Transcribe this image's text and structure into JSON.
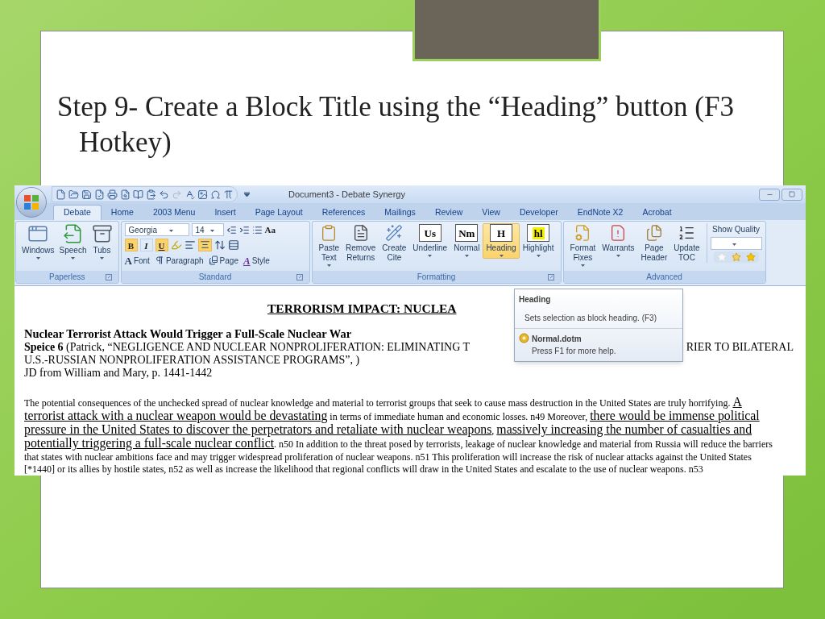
{
  "slide": {
    "title": "Step 9- Create a Block Title using the “Heading” button (F3 Hotkey)"
  },
  "window": {
    "title": "Document3 - Debate Synergy"
  },
  "tabs": [
    {
      "label": "Debate",
      "selected": true
    },
    {
      "label": "Home",
      "selected": false
    },
    {
      "label": "2003 Menu",
      "selected": false
    },
    {
      "label": "Insert",
      "selected": false
    },
    {
      "label": "Page Layout",
      "selected": false
    },
    {
      "label": "References",
      "selected": false
    },
    {
      "label": "Mailings",
      "selected": false
    },
    {
      "label": "Review",
      "selected": false
    },
    {
      "label": "View",
      "selected": false
    },
    {
      "label": "Developer",
      "selected": false
    },
    {
      "label": "EndNote X2",
      "selected": false
    },
    {
      "label": "Acrobat",
      "selected": false
    }
  ],
  "paperless": {
    "name": "Paperless",
    "buttons": [
      {
        "lines": [
          "Windows"
        ],
        "dropdown": true
      },
      {
        "lines": [
          "Speech"
        ],
        "dropdown": true
      },
      {
        "lines": [
          "Tubs"
        ],
        "dropdown": true
      }
    ]
  },
  "standard": {
    "name": "Standard",
    "font": "Georgia",
    "size": "14",
    "grow": "Aa",
    "toggles": [
      {
        "label": "B",
        "on": true
      },
      {
        "label": "I",
        "on": false
      },
      {
        "label": "U",
        "on": true
      }
    ],
    "align_center": true,
    "commands": [
      {
        "glyph": "A",
        "label": "Font"
      },
      {
        "label": "Paragraph"
      },
      {
        "label": "Page"
      },
      {
        "glyph": "A",
        "label": "Style"
      }
    ]
  },
  "formatting": {
    "name": "Formatting",
    "buttons": [
      {
        "kind": "icon",
        "lines": [
          "Paste",
          "Text"
        ],
        "dropdown": true,
        "selected": false
      },
      {
        "kind": "icon",
        "lines": [
          "Remove",
          "Returns"
        ],
        "dropdown": false,
        "selected": false
      },
      {
        "kind": "icon",
        "lines": [
          "Create",
          "Cite"
        ],
        "dropdown": false,
        "selected": false
      },
      {
        "kind": "glyph",
        "glyph": "Us",
        "lines": [
          "Underline"
        ],
        "dropdown": true,
        "selected": false
      },
      {
        "kind": "glyph",
        "glyph": "Nm",
        "lines": [
          "Normal"
        ],
        "dropdown": true,
        "selected": false
      },
      {
        "kind": "glyph",
        "glyph": "H",
        "lines": [
          "Heading"
        ],
        "dropdown": true,
        "selected": true
      },
      {
        "kind": "glyph",
        "glyph": "hl",
        "lines": [
          "Highlight"
        ],
        "dropdown": true,
        "selected": false
      }
    ]
  },
  "advanced": {
    "name": "Advanced",
    "buttons": [
      {
        "lines": [
          "Format",
          "Fixes"
        ],
        "dropdown": true
      },
      {
        "lines": [
          "Warrants"
        ],
        "dropdown": true
      },
      {
        "lines": [
          "Page",
          "Header"
        ],
        "dropdown": false
      },
      {
        "lines": [
          "Update",
          "TOC"
        ],
        "dropdown": false
      }
    ],
    "quality_label": "Show Quality"
  },
  "tooltip": {
    "title": "Heading",
    "description": "Sets selection as block heading. (F3)",
    "template": "Normal.dotm",
    "help": "Press F1 for more help."
  },
  "document": {
    "heading": "TERRORISM IMPACT: NUCLEA",
    "tag": "Nuclear Terrorist Attack Would Trigger a Full-Scale Nuclear War",
    "cite_left": "**Speice 6** (Patrick, “NEGLIGENCE AND NUCLEAR NONPROLIFERATION: ELIMINATING T",
    "cite_right": "RIER TO BILATERAL",
    "cite_line2": "U.S.-RUSSIAN NONPROLIFERATION ASSISTANCE PROGRAMS”, )",
    "cite_line3": "JD from William and Mary, p. 1441-1442",
    "paragraph": [
      [
        {
          "text": "The potential consequences of the unchecked spread of nuclear knowledge and material to terrorist groups that seek to cause mass destruction in the United States are truly horrifying. ",
          "underlined": false
        },
        {
          "text": "A",
          "underlined": true
        }
      ],
      [
        {
          "text": "terrorist attack with a nuclear weapon would be devastating",
          "underlined": true
        },
        {
          "text": " in terms of immediate human and economic losses. n49 Moreover, ",
          "underlined": false
        },
        {
          "text": "there would be immense political",
          "underlined": true
        }
      ],
      [
        {
          "text": "pressure in the United States to discover the perpetrators and retaliate with nuclear weapons",
          "underlined": true
        },
        {
          "text": ", ",
          "underlined": false
        },
        {
          "text": "massively increasing the number of casualties and",
          "underlined": true
        }
      ],
      [
        {
          "text": "potentially triggering a full-scale nuclear conflict",
          "underlined": true
        },
        {
          "text": ". n50 In addition to the threat posed by terrorists, leakage of nuclear knowledge and material from Russia will reduce the barriers",
          "underlined": false
        }
      ],
      [
        {
          "text": "that states with nuclear ambitions face and may trigger widespread proliferation of nuclear weapons. n51 This proliferation will increase the risk of nuclear attacks against the United States",
          "underlined": false
        }
      ],
      [
        {
          "text": "[*1440] or its allies by hostile states, n52 as well as increase the likelihood that regional conflicts will draw in the United States and escalate to the use of nuclear weapons. n53",
          "underlined": false
        }
      ]
    ]
  }
}
